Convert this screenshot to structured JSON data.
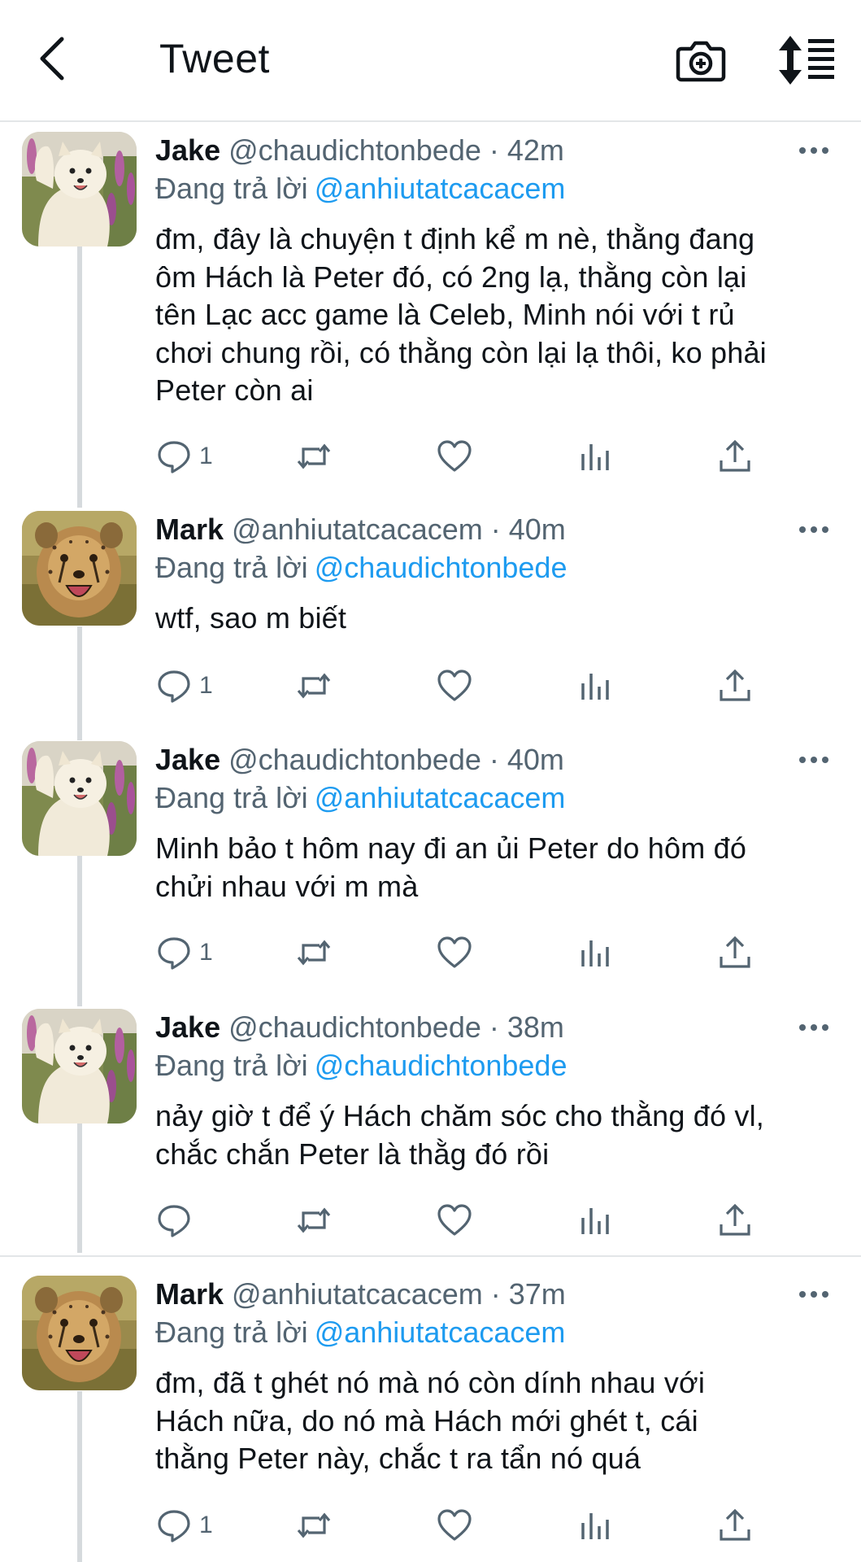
{
  "header": {
    "title": "Tweet",
    "back_icon": "chevron-left-icon",
    "camera_icon": "camera-plus-icon",
    "sort_icon": "sort-list-icon"
  },
  "colors": {
    "link": "#1d9bf0",
    "secondary": "#536471",
    "text": "#0f1419",
    "divider": "#e3e6e8"
  },
  "tweets": [
    {
      "name": "Jake",
      "handle": "@chaudichtonbede · 42m",
      "reply_label": "Đang trả lời",
      "reply_to": "@anhiutatcacacem",
      "lines": [
        "đm, đây là chuyện t định kể m nè, thằng đang",
        "ôm Hách là Peter đó, có 2ng lạ, thằng còn lại",
        "tên Lạc acc game là Celeb, Minh nói với t rủ",
        "chơi chung rồi, có thằng còn lại lạ thôi, ko phải",
        "Peter còn ai"
      ],
      "reply_count": "1",
      "avatar": "samoyed-dog-avatar"
    },
    {
      "name": "Mark",
      "handle": "@anhiutatcacacem · 40m",
      "reply_label": "Đang trả lời",
      "reply_to": "@chaudichtonbede",
      "lines": [
        "wtf, sao m biết"
      ],
      "reply_count": "1",
      "avatar": "cheetah-cub-avatar"
    },
    {
      "name": "Jake",
      "handle": "@chaudichtonbede · 40m",
      "reply_label": "Đang trả lời",
      "reply_to": "@anhiutatcacacem",
      "lines": [
        "Minh bảo t hôm nay đi an ủi Peter do hôm đó",
        "chửi nhau với m mà"
      ],
      "reply_count": "1",
      "avatar": "samoyed-dog-avatar"
    },
    {
      "name": "Jake",
      "handle": "@chaudichtonbede · 38m",
      "reply_label": "Đang trả lời",
      "reply_to": "@chaudichtonbede",
      "lines": [
        "nảy giờ t để ý Hách chăm sóc cho thằng đó vl,",
        "chắc chắn Peter là thằg đó rồi"
      ],
      "reply_count": "",
      "avatar": "samoyed-dog-avatar"
    },
    {
      "name": "Mark",
      "handle": "@anhiutatcacacem · 37m",
      "reply_label": "Đang trả lời",
      "reply_to": "@anhiutatcacacem",
      "lines": [
        "đm, đã t ghét nó mà nó còn dính nhau với",
        "Hách nữa, do nó mà Hách mới ghét t, cái",
        "thằng Peter này, chắc t ra tẩn nó quá"
      ],
      "reply_count": "1",
      "avatar": "cheetah-cub-avatar"
    }
  ]
}
